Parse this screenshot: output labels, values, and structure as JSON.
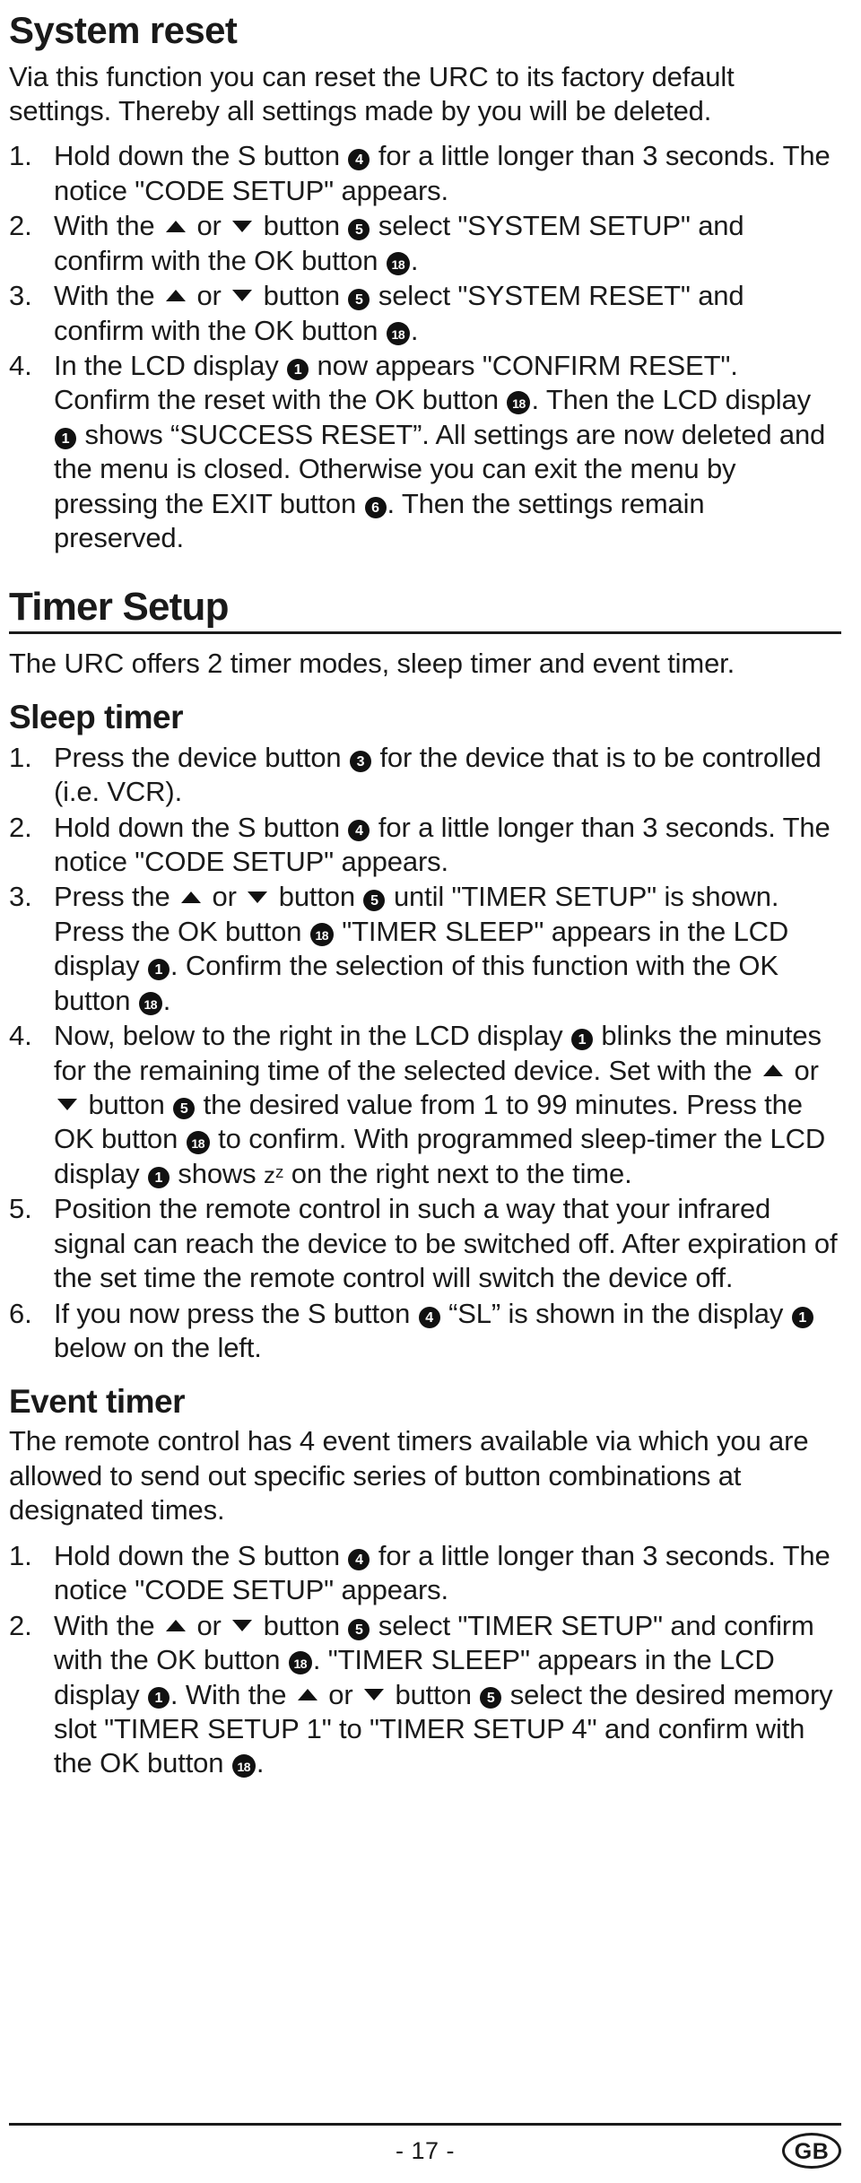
{
  "document": {
    "page_number_label": "- 17 -",
    "locale_badge": "GB"
  },
  "system_reset": {
    "heading": "System reset",
    "intro": "Via this function you can reset the URC to its factory default settings. Thereby all settings made by you will be deleted.",
    "steps": [
      {
        "num": "1.",
        "parts": [
          {
            "t": "text",
            "v": "Hold down the S button "
          },
          {
            "t": "badge",
            "v": "4"
          },
          {
            "t": "text",
            "v": " for a little longer than 3 seconds. The notice \"CODE SETUP\" appears."
          }
        ]
      },
      {
        "num": "2.",
        "parts": [
          {
            "t": "text",
            "v": "With the "
          },
          {
            "t": "arrow-up"
          },
          {
            "t": "text",
            "v": " or "
          },
          {
            "t": "arrow-down"
          },
          {
            "t": "text",
            "v": " button "
          },
          {
            "t": "badge",
            "v": "5"
          },
          {
            "t": "text",
            "v": " select \"SYSTEM SETUP\" and confirm with the OK button "
          },
          {
            "t": "badge",
            "v": "18"
          },
          {
            "t": "text",
            "v": "."
          }
        ]
      },
      {
        "num": "3.",
        "parts": [
          {
            "t": "text",
            "v": "With the "
          },
          {
            "t": "arrow-up"
          },
          {
            "t": "text",
            "v": " or "
          },
          {
            "t": "arrow-down"
          },
          {
            "t": "text",
            "v": " button "
          },
          {
            "t": "badge",
            "v": "5"
          },
          {
            "t": "text",
            "v": " select \"SYSTEM RESET\" and confirm with the OK button "
          },
          {
            "t": "badge",
            "v": "18"
          },
          {
            "t": "text",
            "v": "."
          }
        ]
      },
      {
        "num": "4.",
        "parts": [
          {
            "t": "text",
            "v": "In the LCD display "
          },
          {
            "t": "badge",
            "v": "1"
          },
          {
            "t": "text",
            "v": " now appears \"CONFIRM RESET\". Confirm the reset with the OK button "
          },
          {
            "t": "badge",
            "v": "18"
          },
          {
            "t": "text",
            "v": ". Then the LCD display "
          },
          {
            "t": "badge",
            "v": "1"
          },
          {
            "t": "text",
            "v": " shows “SUCCESS RESET”. All settings are now deleted and the menu is closed. Otherwise you can exit the menu by pressing the EXIT button "
          },
          {
            "t": "badge",
            "v": "6"
          },
          {
            "t": "text",
            "v": ". Then the settings remain preserved."
          }
        ]
      }
    ]
  },
  "timer_setup": {
    "heading": "Timer Setup",
    "intro": "The URC offers 2 timer modes, sleep timer and event timer.",
    "sleep_timer": {
      "heading": "Sleep timer",
      "steps": [
        {
          "num": "1.",
          "parts": [
            {
              "t": "text",
              "v": "Press the device button "
            },
            {
              "t": "badge",
              "v": "3"
            },
            {
              "t": "text",
              "v": " for the device that is to be controlled (i.e. VCR)."
            }
          ]
        },
        {
          "num": "2.",
          "parts": [
            {
              "t": "text",
              "v": "Hold down the S button "
            },
            {
              "t": "badge",
              "v": "4"
            },
            {
              "t": "text",
              "v": " for a little longer than 3 seconds. The notice \"CODE SETUP\" appears."
            }
          ]
        },
        {
          "num": "3.",
          "parts": [
            {
              "t": "text",
              "v": "Press the "
            },
            {
              "t": "arrow-up"
            },
            {
              "t": "text",
              "v": " or "
            },
            {
              "t": "arrow-down"
            },
            {
              "t": "text",
              "v": " button "
            },
            {
              "t": "badge",
              "v": "5"
            },
            {
              "t": "text",
              "v": " until \"TIMER SETUP\" is shown. Press the OK button "
            },
            {
              "t": "badge",
              "v": "18"
            },
            {
              "t": "text",
              "v": " \"TIMER SLEEP\" appears in the LCD display "
            },
            {
              "t": "badge",
              "v": "1"
            },
            {
              "t": "text",
              "v": ".  Confirm the selection of this function with the OK button "
            },
            {
              "t": "badge",
              "v": "18"
            },
            {
              "t": "text",
              "v": "."
            }
          ]
        },
        {
          "num": "4.",
          "parts": [
            {
              "t": "text",
              "v": "Now, below to the right in the LCD display "
            },
            {
              "t": "badge",
              "v": "1"
            },
            {
              "t": "text",
              "v": " blinks the minutes for the remaining time of the selected device. Set with the "
            },
            {
              "t": "arrow-up"
            },
            {
              "t": "text",
              "v": " or "
            },
            {
              "t": "arrow-down"
            },
            {
              "t": "text",
              "v": " button "
            },
            {
              "t": "badge",
              "v": "5"
            },
            {
              "t": "text",
              "v": " the desired value from 1 to 99 minutes. Press the OK button "
            },
            {
              "t": "badge",
              "v": "18"
            },
            {
              "t": "text",
              "v": " to confirm. With programmed sleep-timer the LCD display "
            },
            {
              "t": "badge",
              "v": "1"
            },
            {
              "t": "text",
              "v": " shows "
            },
            {
              "t": "zz",
              "v": "zᶻ"
            },
            {
              "t": "text",
              "v": " on the right next to the time."
            }
          ]
        },
        {
          "num": "5.",
          "parts": [
            {
              "t": "text",
              "v": "Position the remote control in such a way that your infrared signal can reach the device to be switched off. After expiration of the set time the remote control will switch the device off."
            }
          ]
        },
        {
          "num": "6.",
          "parts": [
            {
              "t": "text",
              "v": "If you now press the S button "
            },
            {
              "t": "badge",
              "v": "4"
            },
            {
              "t": "text",
              "v": " “SL” is shown in the display "
            },
            {
              "t": "badge",
              "v": "1"
            },
            {
              "t": "text",
              "v": " below on the left."
            }
          ]
        }
      ]
    },
    "event_timer": {
      "heading": "Event timer",
      "intro": "The remote control has 4 event timers available via which you are allowed to send out specific series of button combinations at designated times.",
      "steps": [
        {
          "num": "1.",
          "parts": [
            {
              "t": "text",
              "v": "Hold down the S button "
            },
            {
              "t": "badge",
              "v": "4"
            },
            {
              "t": "text",
              "v": " for a little longer than 3 seconds. The notice \"CODE SETUP\" appears."
            }
          ]
        },
        {
          "num": "2.",
          "parts": [
            {
              "t": "text",
              "v": "With the "
            },
            {
              "t": "arrow-up"
            },
            {
              "t": "text",
              "v": " or "
            },
            {
              "t": "arrow-down"
            },
            {
              "t": "text",
              "v": " button "
            },
            {
              "t": "badge",
              "v": "5"
            },
            {
              "t": "text",
              "v": " select \"TIMER SETUP\" and confirm with the OK button "
            },
            {
              "t": "badge",
              "v": "18"
            },
            {
              "t": "text",
              "v": ". \"TIMER SLEEP\" appears in the LCD display "
            },
            {
              "t": "badge",
              "v": "1"
            },
            {
              "t": "text",
              "v": ".  With the "
            },
            {
              "t": "arrow-up"
            },
            {
              "t": "text",
              "v": " or "
            },
            {
              "t": "arrow-down"
            },
            {
              "t": "text",
              "v": " button "
            },
            {
              "t": "badge",
              "v": "5"
            },
            {
              "t": "text",
              "v": " select the desired memory slot \"TIMER SETUP 1\" to \"TIMER SETUP 4\" and confirm with the OK button "
            },
            {
              "t": "badge",
              "v": "18"
            },
            {
              "t": "text",
              "v": "."
            }
          ]
        }
      ]
    }
  }
}
